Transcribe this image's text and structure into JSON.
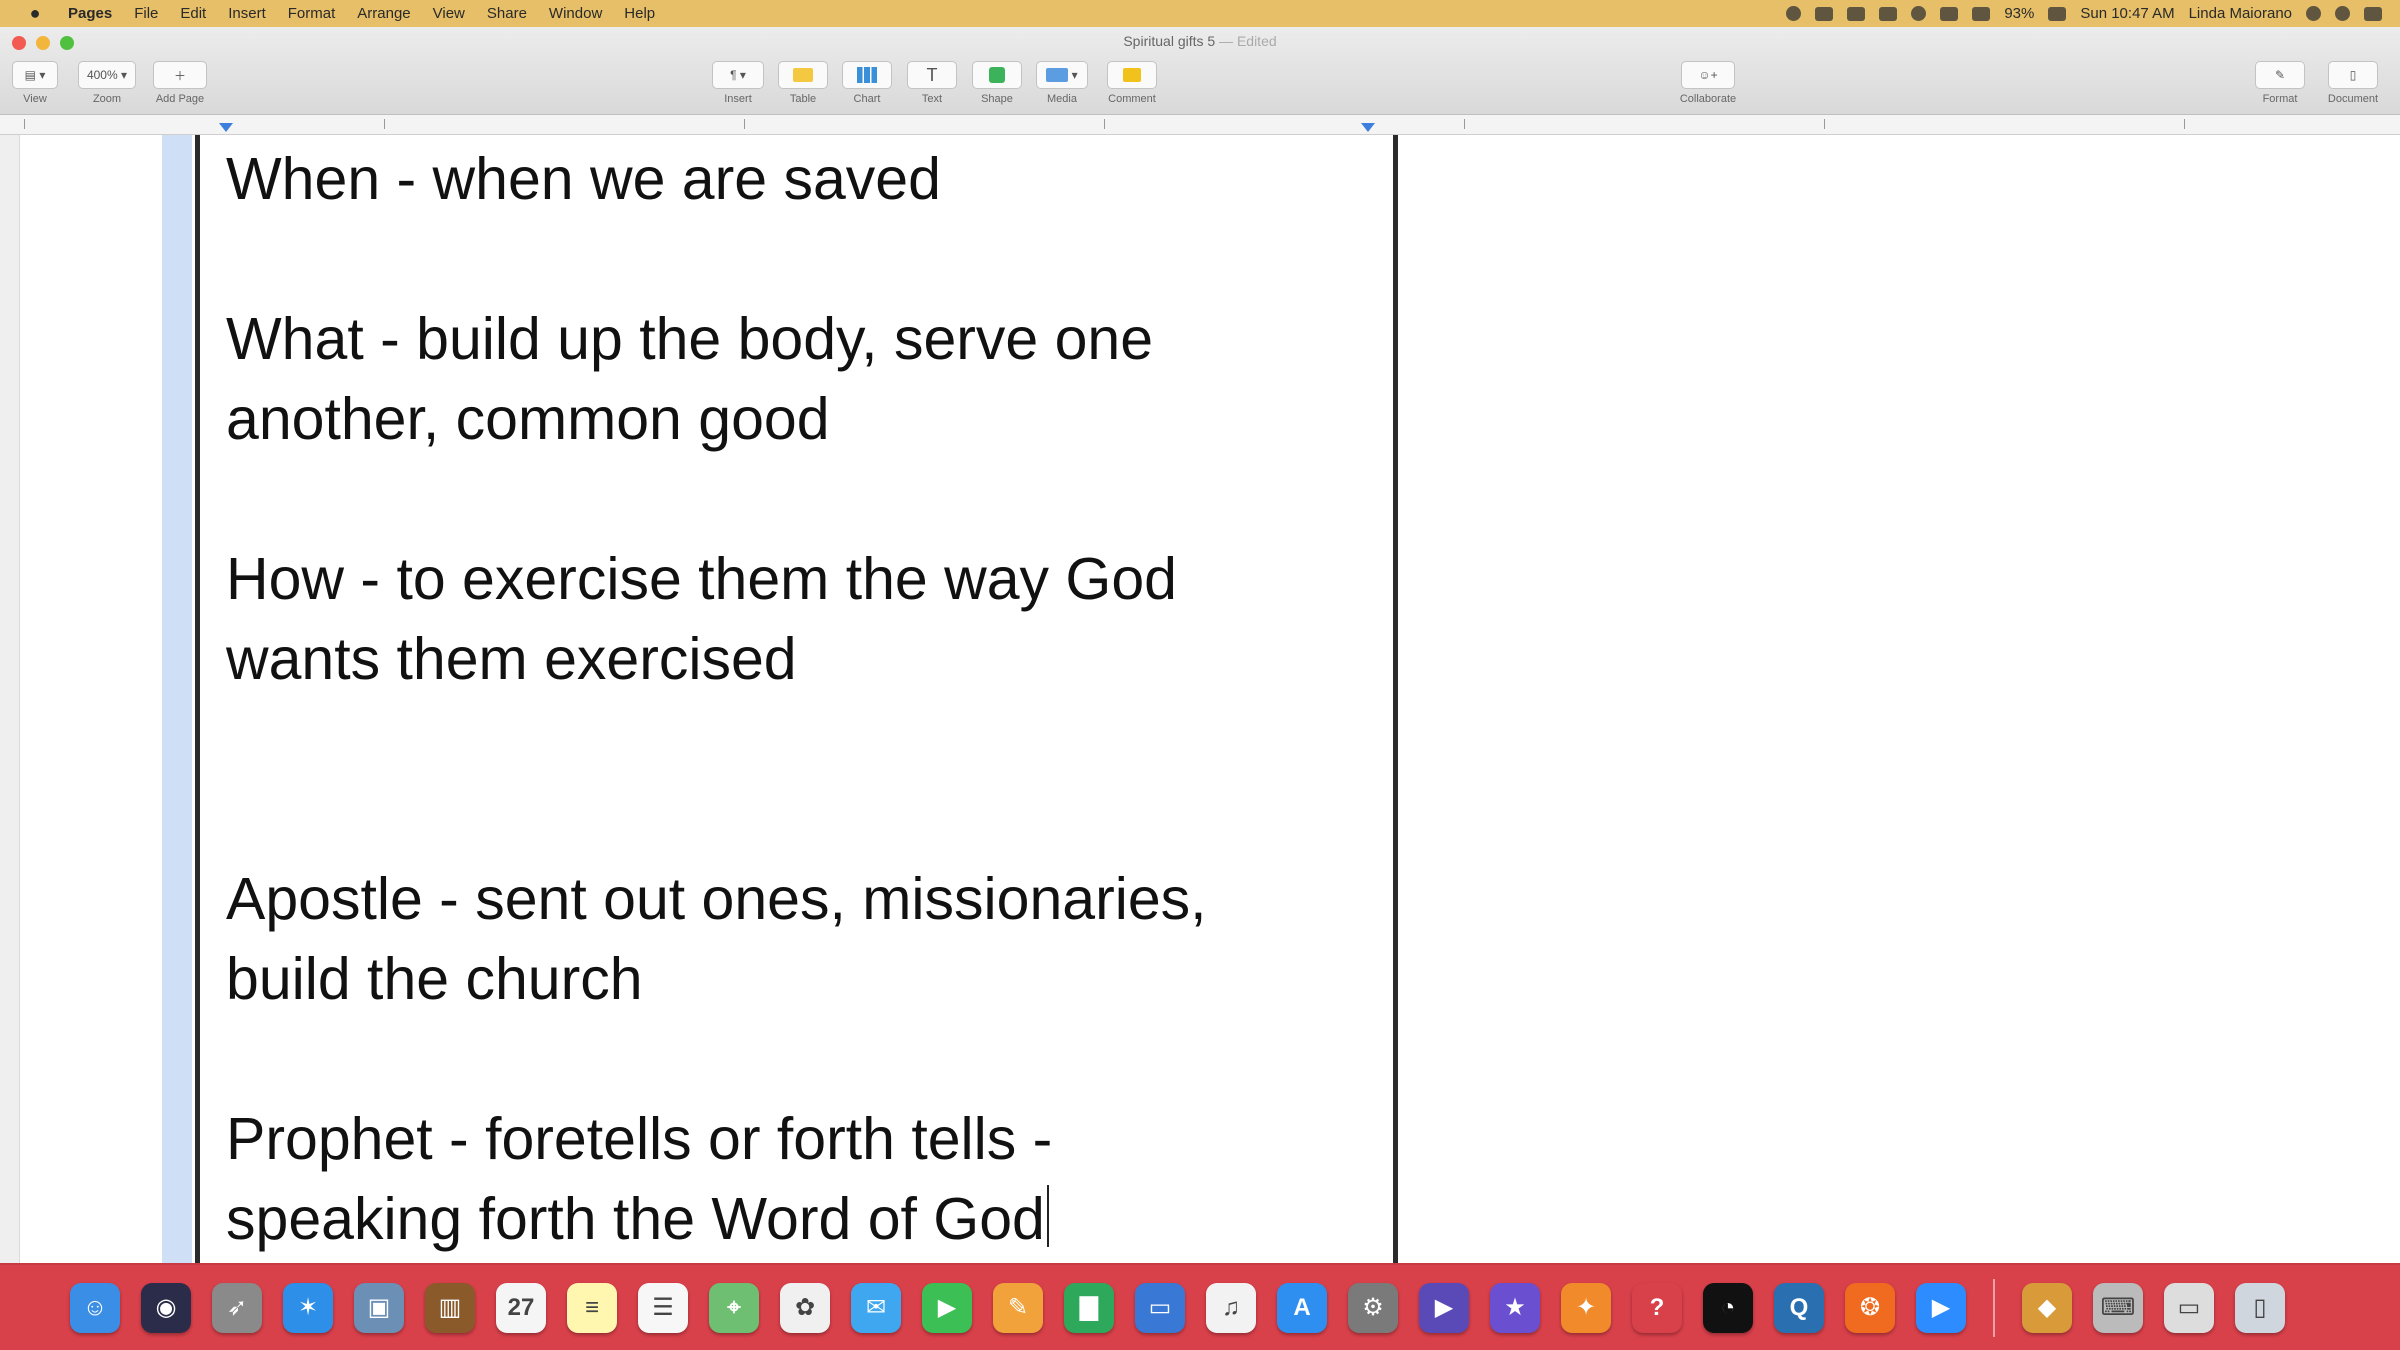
{
  "menubar": {
    "apple": "",
    "app_name": "Pages",
    "items": [
      "File",
      "Edit",
      "Insert",
      "Format",
      "Arrange",
      "View",
      "Share",
      "Window",
      "Help"
    ],
    "battery": "93%",
    "clock": "Sun 10:47 AM",
    "user": "Linda Maiorano"
  },
  "window": {
    "title": "Spiritual gifts 5",
    "edited": " — Edited"
  },
  "toolbar": {
    "view_label": "View",
    "zoom_value": "400%",
    "zoom_label": "Zoom",
    "add_page_label": "Add Page",
    "insert_label": "Insert",
    "table_label": "Table",
    "chart_label": "Chart",
    "text_label": "Text",
    "shape_label": "Shape",
    "media_label": "Media",
    "comment_label": "Comment",
    "collaborate_label": "Collaborate",
    "format_label": "Format",
    "document_label": "Document"
  },
  "document": {
    "lines": [
      "When - when we are saved",
      "What - build up the body, serve one",
      "another, common good",
      "How - to exercise them the way God",
      "wants them exercised",
      "Apostle - sent out ones, missionaries,",
      "build the church",
      "Prophet - foretells or forth tells -",
      "speaking forth the Word of God"
    ]
  },
  "dock": {
    "calendar_day": "27",
    "apps": [
      {
        "name": "finder-icon",
        "color": "#3b8ee6",
        "glyph": "☺"
      },
      {
        "name": "siri-icon",
        "color": "#2b2b4a",
        "glyph": "◉"
      },
      {
        "name": "launchpad-icon",
        "color": "#8a8a8a",
        "glyph": "➶"
      },
      {
        "name": "safari-icon",
        "color": "#2d8fe8",
        "glyph": "✶"
      },
      {
        "name": "preview-icon",
        "color": "#6b8fb5",
        "glyph": "▣"
      },
      {
        "name": "notebook-icon",
        "color": "#8b5a2b",
        "glyph": "▥"
      },
      {
        "name": "calendar-icon",
        "color": "#f5f5f5",
        "glyph": "27"
      },
      {
        "name": "notes-icon",
        "color": "#fff7b0",
        "glyph": "≡"
      },
      {
        "name": "reminders-icon",
        "color": "#f7f7f7",
        "glyph": "☰"
      },
      {
        "name": "maps-icon",
        "color": "#6fbf73",
        "glyph": "⌖"
      },
      {
        "name": "photos-icon",
        "color": "#f0f0f0",
        "glyph": "✿"
      },
      {
        "name": "messages-icon",
        "color": "#3ea7f0",
        "glyph": "✉"
      },
      {
        "name": "facetime-icon",
        "color": "#3cbf55",
        "glyph": "▶"
      },
      {
        "name": "pages-icon",
        "color": "#f1a23a",
        "glyph": "✎"
      },
      {
        "name": "numbers-icon",
        "color": "#2ea85a",
        "glyph": "▇"
      },
      {
        "name": "keynote-icon",
        "color": "#3a78d6",
        "glyph": "▭"
      },
      {
        "name": "itunes-icon",
        "color": "#f2f2f2",
        "glyph": "♫"
      },
      {
        "name": "app-store-icon",
        "color": "#2f8ff0",
        "glyph": "A"
      },
      {
        "name": "system-preferences-icon",
        "color": "#7a7a7a",
        "glyph": "⚙"
      },
      {
        "name": "player-icon",
        "color": "#5a4ab8",
        "glyph": "▶"
      },
      {
        "name": "imovie-icon",
        "color": "#6a4fd0",
        "glyph": "★"
      },
      {
        "name": "ibooks-icon",
        "color": "#f08a2a",
        "glyph": "✦"
      },
      {
        "name": "help-icon",
        "color": "#d8404a",
        "glyph": "?"
      },
      {
        "name": "speedometer-icon",
        "color": "#111111",
        "glyph": "◔"
      },
      {
        "name": "quicktime-icon",
        "color": "#2a6fb0",
        "glyph": "Q"
      },
      {
        "name": "firefox-icon",
        "color": "#f06a1f",
        "glyph": "❂"
      },
      {
        "name": "zoom-icon",
        "color": "#2d8cff",
        "glyph": "▶"
      }
    ],
    "right_apps": [
      {
        "name": "stack-icon",
        "color": "#d99a3a",
        "glyph": "◆"
      },
      {
        "name": "keyboard-icon",
        "color": "#bbbbbb",
        "glyph": "⌨"
      },
      {
        "name": "screenshot-icon",
        "color": "#dddddd",
        "glyph": "▭"
      },
      {
        "name": "trash-icon",
        "color": "#cfd6de",
        "glyph": "▯"
      }
    ]
  }
}
